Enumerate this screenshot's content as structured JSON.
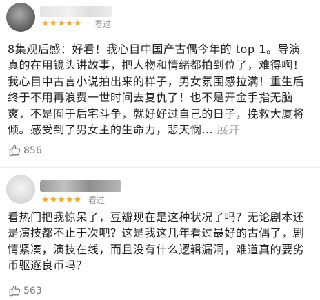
{
  "reviews": [
    {
      "stars": "★★★★★",
      "status": "看过",
      "text": "8集观后感：好看！我心目中国产古偶今年的 top 1。导演真的在用镜头讲故事，把人物和情绪都拍到位了，难得啊！我心目中古言小说拍出来的样子，男女氛围感拉满！重生后终于不用再浪费一世时间去复仇了！也不是开金手指无脑爽，不是囿于后宅斗争，就好好过自己的日子，挽救大厦将倾。感受到了男女主的生命力，悲天悯…",
      "expand": "展开",
      "likes": "856"
    },
    {
      "stars": "★★★★★",
      "status": "看过",
      "text": "看热门把我惊呆了，豆瓣现在是这种状况了吗？无论剧本还是演技都不止于次吧？这是我这几年看过最好的古偶了，剧情紧凑，演技在线，而且没有什么逻辑漏洞，难道真的要劣币驱逐良币吗？",
      "likes": "563"
    }
  ],
  "colors": {
    "star": "#f5a623",
    "text": "#222222",
    "muted": "#9a9a9a"
  },
  "icons": {
    "like": "thumb-up-icon"
  }
}
